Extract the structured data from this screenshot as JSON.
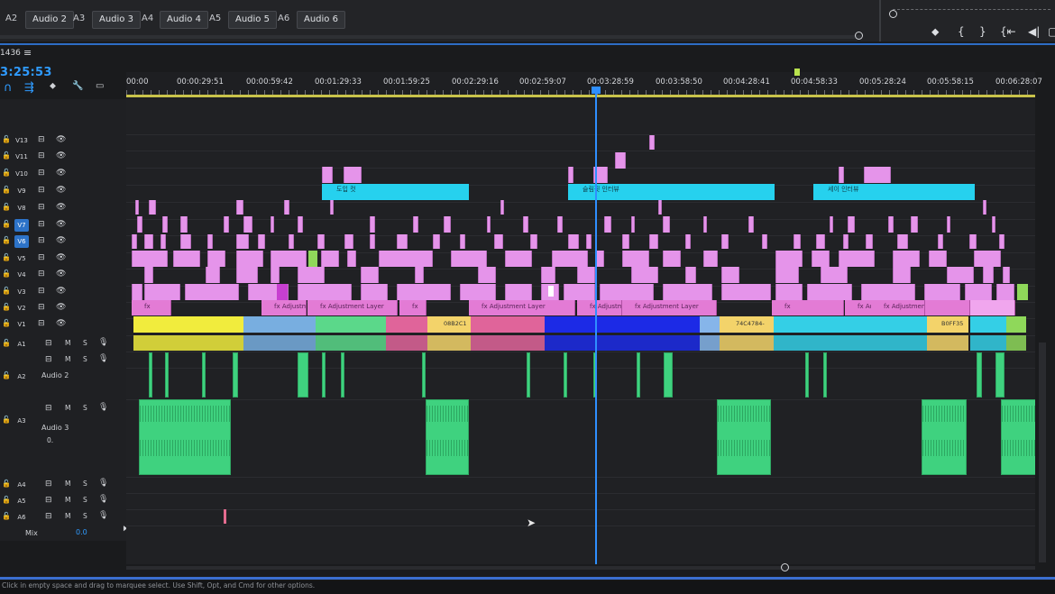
{
  "mixer_tabs": [
    {
      "id": "A2",
      "name": "Audio 2"
    },
    {
      "id": "A3",
      "name": "Audio 3"
    },
    {
      "id": "A4",
      "name": "Audio 4"
    },
    {
      "id": "A5",
      "name": "Audio 5"
    },
    {
      "id": "A6",
      "name": "Audio 6"
    }
  ],
  "program_buttons": [
    "⬥",
    "{",
    "}",
    "{⇤",
    "◀|",
    "▢"
  ],
  "sequence": {
    "name": "1436",
    "menu_icon": "≡",
    "timecode": "3:25:53"
  },
  "tools": {
    "snap": "∩",
    "linked": "⇶",
    "marker": "⬥",
    "wrench": "🔧",
    "captions": "▭"
  },
  "ruler_labels": [
    "00:00",
    "00:00:29:51",
    "00:00:59:42",
    "00:01:29:33",
    "00:01:59:25",
    "00:02:29:16",
    "00:02:59:07",
    "00:03:28:59",
    "00:03:58:50",
    "00:04:28:41",
    "00:04:58:33",
    "00:05:28:24",
    "00:05:58:15",
    "00:06:28:07"
  ],
  "video_tracks": [
    "V13",
    "V11",
    "V10",
    "V9",
    "V8",
    "V7",
    "V6",
    "V5",
    "V4",
    "V3",
    "V2",
    "V1"
  ],
  "selected_tracks": [
    "V7",
    "V6"
  ],
  "audio_tracks": [
    {
      "id": "A1",
      "name": ""
    },
    {
      "id": "",
      "name": ""
    },
    {
      "id": "A2",
      "name": "Audio 2"
    },
    {
      "id": "A3",
      "name": "Audio 3"
    },
    {
      "id": "A4",
      "name": ""
    },
    {
      "id": "A5",
      "name": ""
    },
    {
      "id": "A6",
      "name": ""
    }
  ],
  "track_buttons": {
    "mute": "M",
    "solo": "S",
    "lock": "🔓",
    "eye": "👁",
    "sync": "⊟",
    "mic": "🎙"
  },
  "a3_keyframe_nav": "0.",
  "mix": {
    "label": "Mix",
    "value": "0.0"
  },
  "title_clips": [
    {
      "label": "도입 컷"
    },
    {
      "label": "슬림핏 인터뷰"
    },
    {
      "label": "세이 인터뷰"
    }
  ],
  "adjustment_labels": [
    "fx",
    "fx Adjustme",
    "fx Adjustment Layer",
    "fx",
    "fx Adjustment Layer",
    "fx Adjustm",
    "fx Adjustment Layer",
    "fx",
    "fx Adjustment La",
    "fx Adjustment"
  ],
  "v1_labels": [
    "08B2C1",
    "74C4784-",
    "B0FF35"
  ],
  "status_text": "Click in empty space and drag to marquee select. Use Shift, Opt, and Cmd for other options.",
  "colors": {
    "playhead": "#2f8fff",
    "selected_track": "#2d73c8",
    "title_clip": "#26d1ee",
    "graphic_clip": "#e594ea",
    "audio_clip": "#3fd27f",
    "work_area": "#c9c34a"
  }
}
